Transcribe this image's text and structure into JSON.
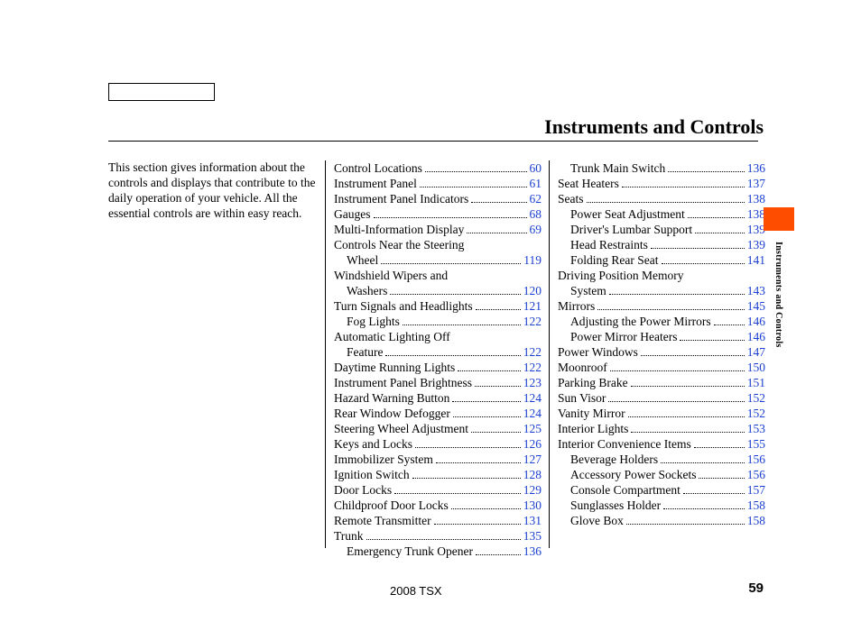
{
  "title": "Instruments and Controls",
  "intro": "This section gives information about the controls and displays that contribute to the daily operation of your vehicle. All the essential controls are within easy reach.",
  "side_tab_label": "Instruments and Controls",
  "footer_model": "2008  TSX",
  "footer_page": "59",
  "col_mid": [
    {
      "label": "Control Locations",
      "page": "60"
    },
    {
      "label": "Instrument Panel",
      "page": "61"
    },
    {
      "label": "Instrument Panel Indicators",
      "page": "62"
    },
    {
      "label": "Gauges",
      "page": "68"
    },
    {
      "label": "Multi-Information Display",
      "page": "69"
    },
    {
      "wrap_first": "Controls Near the Steering",
      "wrap_second": "Wheel",
      "page": "119",
      "indent": true
    },
    {
      "wrap_first": "Windshield Wipers and",
      "wrap_second": "Washers",
      "page": "120",
      "indent": true
    },
    {
      "label": "Turn Signals and Headlights",
      "page": "121"
    },
    {
      "label": "Fog Lights",
      "page": "122",
      "indent": true
    },
    {
      "wrap_first": "Automatic Lighting Off",
      "wrap_second": "Feature",
      "page": "122",
      "indent": true
    },
    {
      "label": "Daytime Running Lights",
      "page": "122"
    },
    {
      "label": "Instrument Panel Brightness",
      "page": "123"
    },
    {
      "label": "Hazard Warning Button",
      "page": "124"
    },
    {
      "label": "Rear Window Defogger",
      "page": "124"
    },
    {
      "label": "Steering Wheel Adjustment",
      "page": "125"
    },
    {
      "label": "Keys and Locks",
      "page": "126"
    },
    {
      "label": "Immobilizer System",
      "page": "127"
    },
    {
      "label": "Ignition Switch",
      "page": "128"
    },
    {
      "label": "Door Locks",
      "page": "129"
    },
    {
      "label": "Childproof Door Locks",
      "page": "130"
    },
    {
      "label": "Remote Transmitter",
      "page": "131"
    },
    {
      "label": "Trunk",
      "page": "135"
    },
    {
      "label": "Emergency Trunk Opener",
      "page": "136",
      "indent": true
    }
  ],
  "col_right": [
    {
      "label": "Trunk Main Switch",
      "page": "136",
      "indent": true
    },
    {
      "label": "Seat Heaters",
      "page": "137"
    },
    {
      "label": "Seats",
      "page": "138"
    },
    {
      "label": "Power Seat Adjustment",
      "page": "138",
      "indent": true
    },
    {
      "label": "Driver's Lumbar Support",
      "page": "139",
      "indent": true
    },
    {
      "label": "Head Restraints",
      "page": "139",
      "indent": true
    },
    {
      "label": "Folding Rear Seat",
      "page": "141",
      "indent": true
    },
    {
      "wrap_first": "Driving Position Memory",
      "wrap_second": "System",
      "page": "143",
      "indent": true
    },
    {
      "label": "Mirrors",
      "page": "145"
    },
    {
      "label": "Adjusting the Power Mirrors",
      "page": "146",
      "indent": true
    },
    {
      "label": "Power Mirror Heaters",
      "page": "146",
      "indent": true
    },
    {
      "label": "Power Windows",
      "page": "147"
    },
    {
      "label": "Moonroof",
      "page": "150"
    },
    {
      "label": "Parking Brake",
      "page": "151"
    },
    {
      "label": "Sun Visor",
      "page": "152"
    },
    {
      "label": "Vanity Mirror",
      "page": "152"
    },
    {
      "label": "Interior Lights",
      "page": "153"
    },
    {
      "label": "Interior Convenience Items",
      "page": "155"
    },
    {
      "label": "Beverage Holders",
      "page": "156",
      "indent": true
    },
    {
      "label": "Accessory Power Sockets",
      "page": "156",
      "indent": true
    },
    {
      "label": "Console Compartment",
      "page": "157",
      "indent": true
    },
    {
      "label": "Sunglasses Holder",
      "page": "158",
      "indent": true
    },
    {
      "label": "Glove Box",
      "page": "158",
      "indent": true
    }
  ]
}
